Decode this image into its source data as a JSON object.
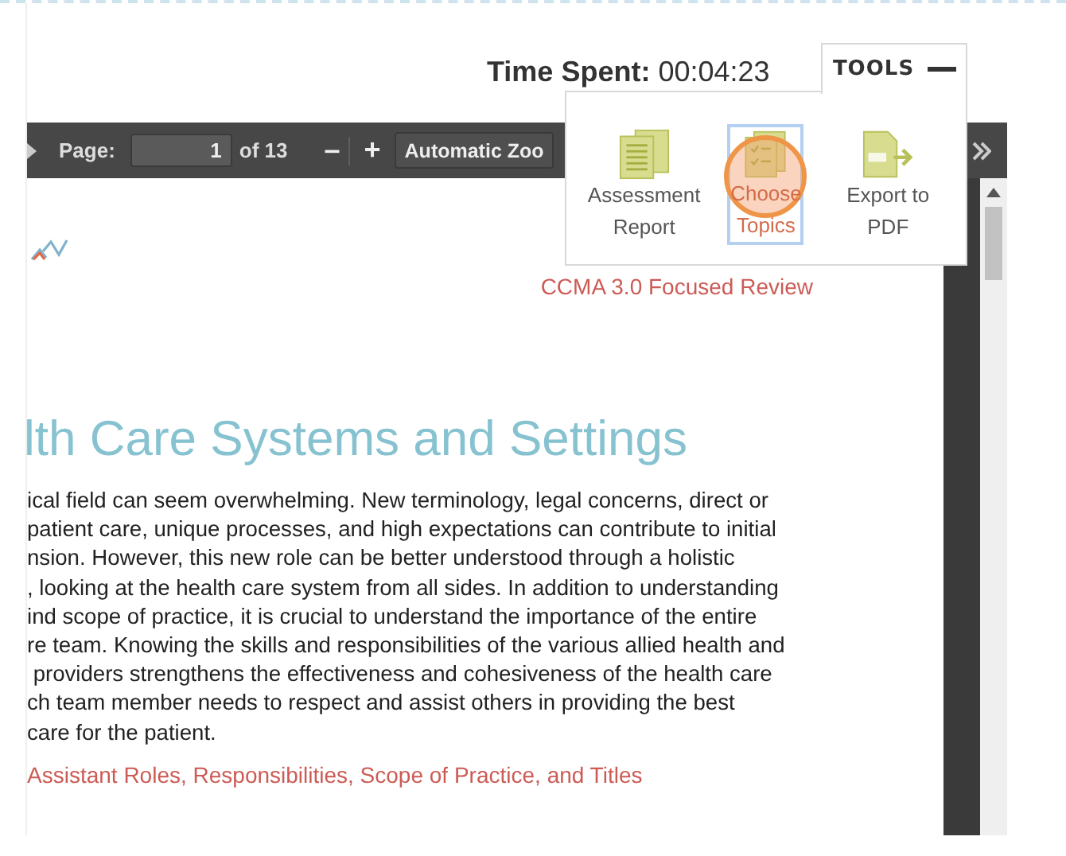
{
  "timer": {
    "label": "Time Spent:",
    "value": "00:04:23"
  },
  "tools": {
    "label": "TOOLS",
    "expanded": true,
    "items": [
      {
        "kind": "report",
        "label": "Assessment Report",
        "selected": false
      },
      {
        "kind": "topics",
        "label": "Choose Topics",
        "selected": true
      },
      {
        "kind": "pdf",
        "label": "Export to PDF",
        "selected": false
      }
    ]
  },
  "toolbar": {
    "page_label": "Page:",
    "page_value": "1",
    "page_count": "of 13",
    "zoom_out": "–",
    "zoom_in": "+",
    "zoom": "Automatic Zoo"
  },
  "document": {
    "header": "CCMA 3.0 Focused Review",
    "title": "lth Care Systems and Settings",
    "lines": [
      "ical field can seem overwhelming. New terminology, legal concerns, direct or",
      "patient care, unique processes, and high expectations can contribute to initial",
      "nsion. However, this new role can be better understood through a holistic",
      ", looking at the health care system from all sides. In addition to understanding",
      "ind scope of practice, it is crucial to understand the importance of the entire",
      "re team. Knowing the skills and responsibilities of the various allied health and",
      " providers strengthens the effectiveness and cohesiveness of the health care",
      "ch team member needs to respect and assist others in providing the best",
      "care for the patient."
    ],
    "subheading": "Assistant Roles, Responsibilities, Scope of Practice, and Titles"
  }
}
